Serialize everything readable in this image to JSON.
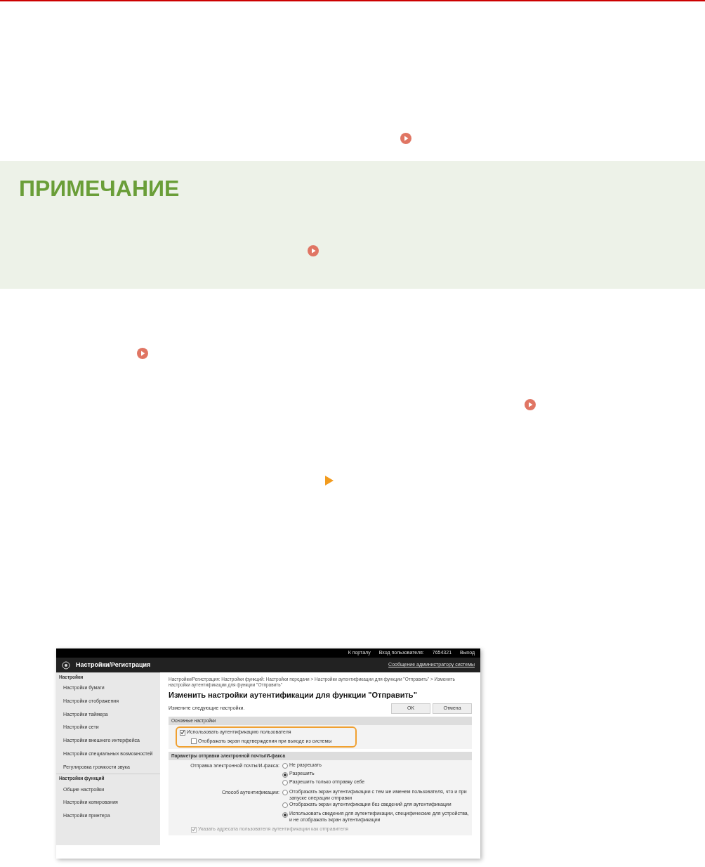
{
  "note": {
    "heading": "ПРИМЕЧАНИЕ"
  },
  "screenshot": {
    "top_bar": {
      "links": [
        "К порталу",
        "Вход пользователя:",
        "7654321",
        "Выход"
      ]
    },
    "header": {
      "title": "Настройки/Регистрация",
      "admin_link": "Сообщение администратору системы"
    },
    "sidebar": [
      {
        "heading": "Настройки",
        "items": [
          "Настройки бумаги",
          "Настройки отображения",
          "Настройки таймера",
          "Настройки сети",
          "Настройки внешнего интерфейса",
          "Настройки специальных возможностей",
          "Регулировка громкости звука"
        ]
      },
      {
        "heading": "Настройки функций",
        "items": [
          "Общие настройки",
          "Настройки копирования",
          "Настройки принтера"
        ]
      }
    ],
    "breadcrumb": "Настройки/Регистрация: Настройки функций: Настройки передачи > Настройки аутентификации для функции \"Отправить\" > Изменить настройки аутентификации для функции \"Отправить\"",
    "title": "Изменить настройки аутентификации для функции \"Отправить\"",
    "instruction": "Измените следующие настройки.",
    "buttons": [
      "OK",
      "Отмена"
    ],
    "basic_section": {
      "heading": "Основные настройки",
      "options": [
        {
          "label": "Использовать аутентификацию пользователя",
          "checked": true
        },
        {
          "label": "Отображать экран подтверждения при выходе из системы",
          "checked": false
        }
      ]
    },
    "send_section": {
      "heading": "Параметры отправки электронной почты/И-факса",
      "rows": [
        {
          "label": "Отправка электронной почты/И-факса:",
          "options": [
            {
              "label": "Не разрешать",
              "selected": false
            },
            {
              "label": "Разрешить",
              "selected": true
            },
            {
              "label": "Разрешить только отправку себе",
              "selected": false
            }
          ]
        },
        {
          "label": "Способ аутентификации:",
          "options": [
            {
              "label": "Отображать экран аутентификации с тем же именем пользователя, что и при запуске операции отправки",
              "selected": false
            },
            {
              "label": "Отображать экран аутентификации без сведений для аутентификации",
              "selected": false
            },
            {
              "label": "Использовать сведения для аутентификации, специфические для устройства, и не отображать экран аутентификации",
              "selected": true
            }
          ]
        }
      ],
      "sender_option": {
        "label": "Указать адресата пользователя аутентификации как отправителя",
        "checked": true
      }
    }
  }
}
